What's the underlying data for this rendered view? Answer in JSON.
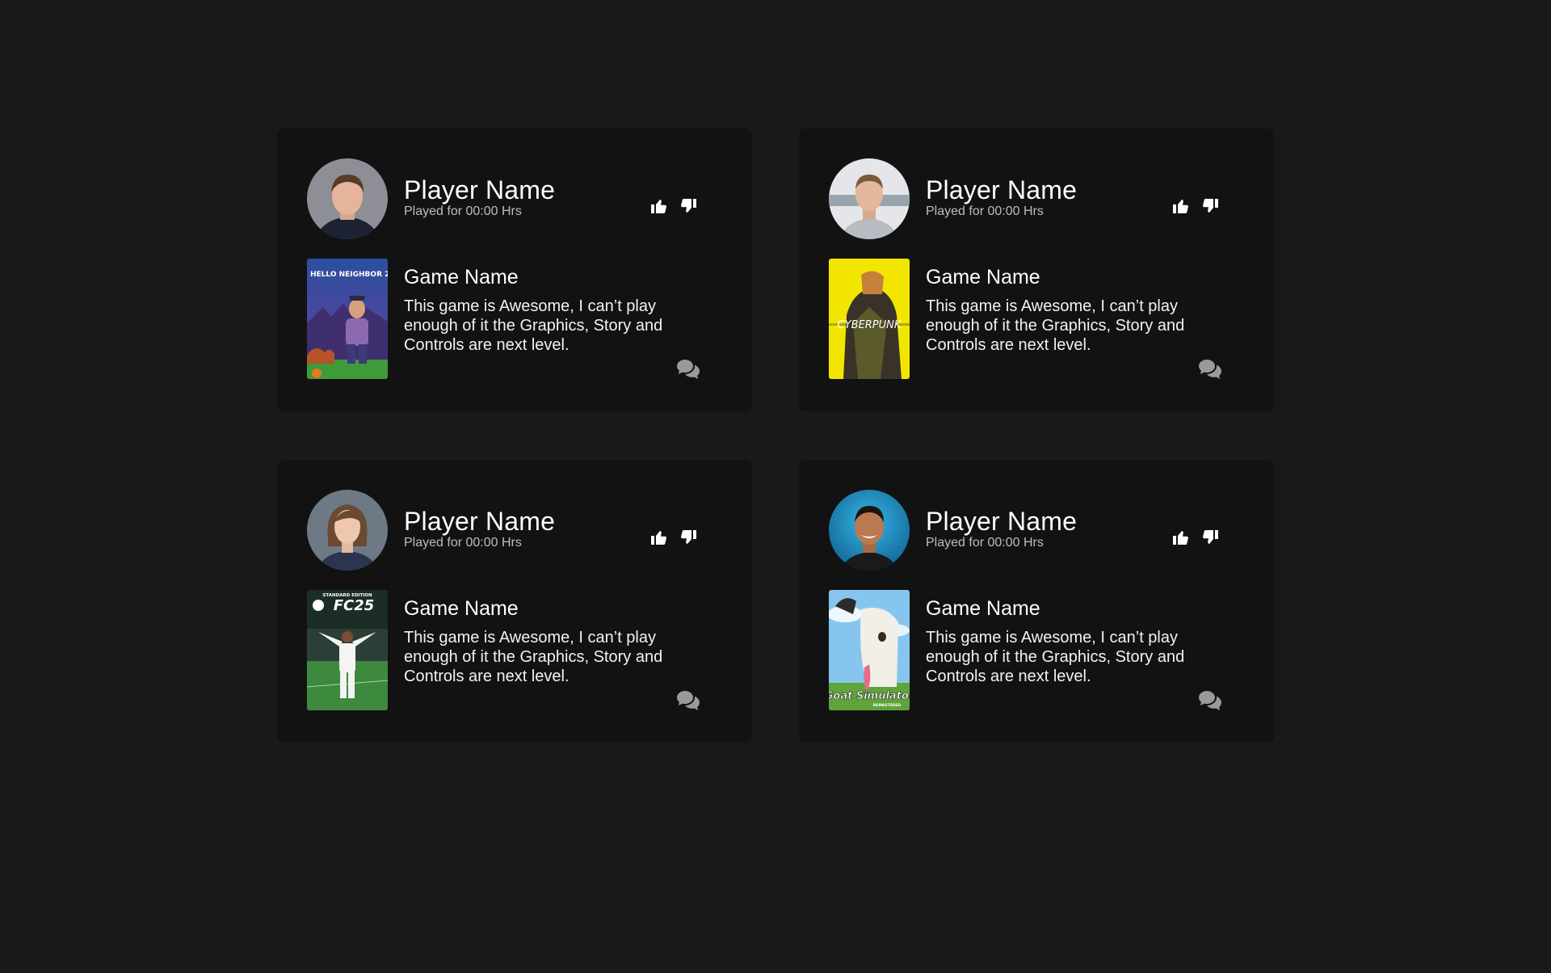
{
  "cards": [
    {
      "player_name": "Player Name",
      "played_for": "Played for 00:00 Hrs",
      "game_name": "Game Name",
      "review": "This game is Awesome, I can’t play enough of it the Graphics, Story and Controls are next level.",
      "avatar": "avatar-young-man",
      "cover": "hello-neighbor-cover",
      "cover_text": "HELLO NEIGHBOR 2"
    },
    {
      "player_name": "Player Name",
      "played_for": "Played for 00:00 Hrs",
      "game_name": "Game Name",
      "review": "This game is Awesome, I can’t play enough of it the Graphics, Story and Controls are next level.",
      "avatar": "avatar-smiling-man",
      "cover": "cyberpunk-cover",
      "cover_text": "CYBERPUNK"
    },
    {
      "player_name": "Player Name",
      "played_for": "Played for 00:00 Hrs",
      "game_name": "Game Name",
      "review": "This game is Awesome, I can’t play enough of it the Graphics, Story and Controls are next level.",
      "avatar": "avatar-woman",
      "cover": "fc25-cover",
      "cover_text": "FC25",
      "cover_subtext": "STANDARD EDITION"
    },
    {
      "player_name": "Player Name",
      "played_for": "Played for 00:00 Hrs",
      "game_name": "Game Name",
      "review": "This game is Awesome, I can’t play enough of it the Graphics, Story and Controls are next level.",
      "avatar": "avatar-man-blue",
      "cover": "goat-simulator-cover",
      "cover_text": "Goat Simulator",
      "cover_subtext": "REMASTERED"
    }
  ],
  "icons": {
    "like": "thumbs-up-icon",
    "dislike": "thumbs-down-icon",
    "comment": "comment-bubbles-icon"
  },
  "colors": {
    "page_background": "#191919",
    "card_background": "#121212",
    "text_primary": "#ffffff",
    "text_secondary": "#bdbdbd"
  }
}
